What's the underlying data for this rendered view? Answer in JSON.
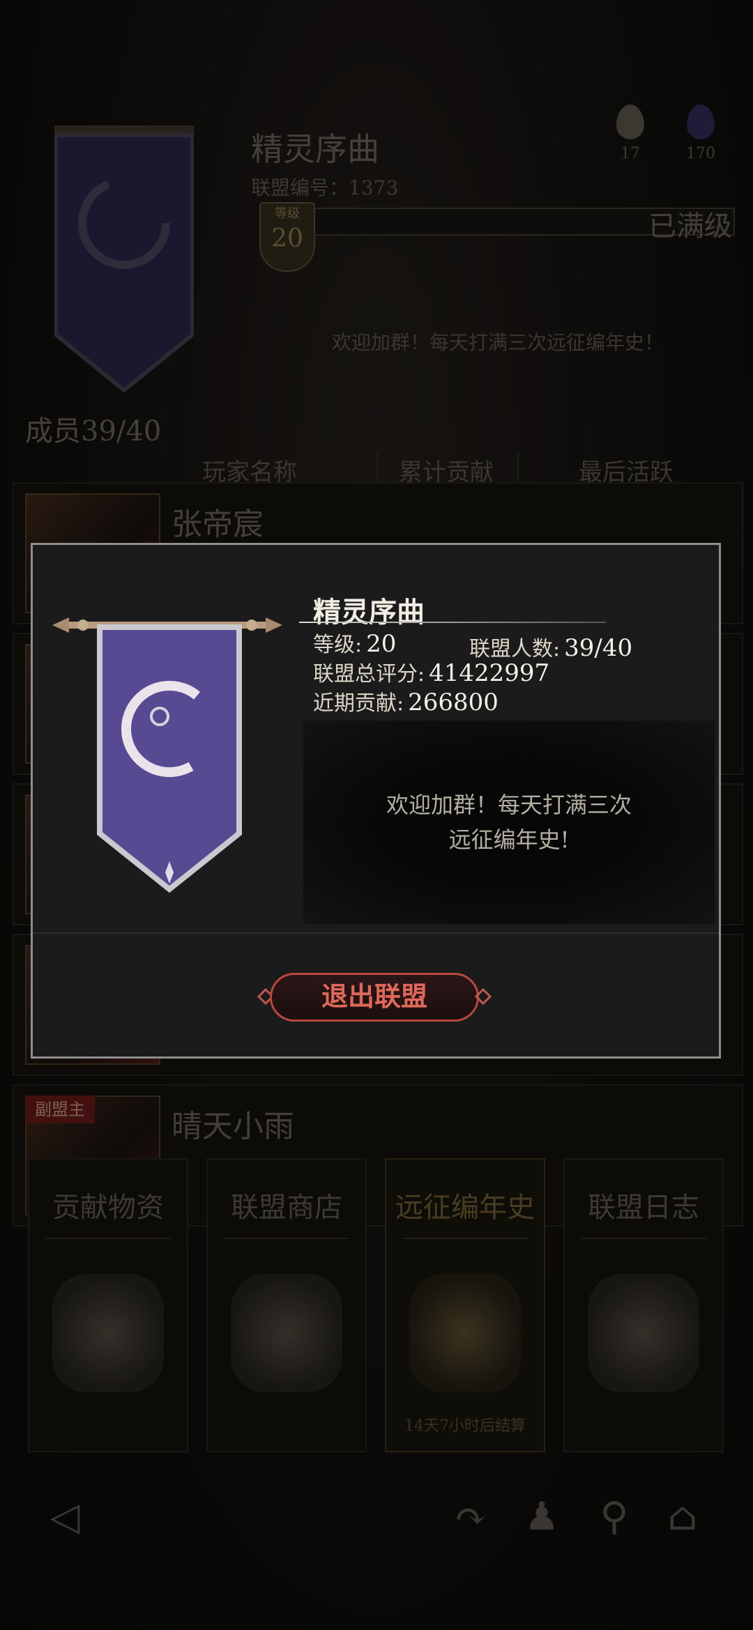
{
  "background": {
    "guild_name": "精灵序曲",
    "guild_id_label": "联盟编号：1373",
    "resources": [
      {
        "icon": "silver-egg-icon",
        "count": "17",
        "color": "#8a8576"
      },
      {
        "icon": "purple-gem-icon",
        "count": "170",
        "color": "#4a3d7a"
      }
    ],
    "level_badge_label": "等级",
    "level": "20",
    "level_status": "已满级",
    "welcome": "欢迎加群！每天打满三次远征编年史！",
    "members": "成员39/40",
    "columns": [
      "玩家名称",
      "累计贡献",
      "最后活跃"
    ],
    "rows": [
      {
        "name": "张帝宸",
        "tag": ""
      },
      {
        "name": "",
        "tag": ""
      },
      {
        "name": "",
        "tag": ""
      },
      {
        "name": "",
        "tag": ""
      },
      {
        "name": "晴天小雨",
        "tag": "副盟主"
      }
    ],
    "actions": [
      {
        "label": "贡献物资",
        "icon": "supplies-icon",
        "sub": ""
      },
      {
        "label": "联盟商店",
        "icon": "armor-shop-icon",
        "sub": ""
      },
      {
        "label": "远征编年史",
        "icon": "crossed-swords-banner-icon",
        "sub": "14天7小时后结算"
      },
      {
        "label": "联盟日志",
        "icon": "scroll-log-icon",
        "sub": ""
      }
    ],
    "bottom_icons": [
      "back-icon",
      "share-icon",
      "members-icon",
      "search-icon",
      "guild-hall-icon"
    ]
  },
  "modal": {
    "guild_name": "精灵序曲",
    "level_label": "等级:",
    "level_value": "20",
    "member_count_label": "联盟人数:",
    "member_count_value": "39/40",
    "total_score_label": "联盟总评分:",
    "total_score_value": "41422997",
    "recent_contrib_label": "近期贡献:",
    "recent_contrib_value": "266800",
    "notice_line1": "欢迎加群！每天打满三次",
    "notice_line2": "远征编年史!",
    "leave_button": "退出联盟",
    "accent": "#d0574b"
  }
}
